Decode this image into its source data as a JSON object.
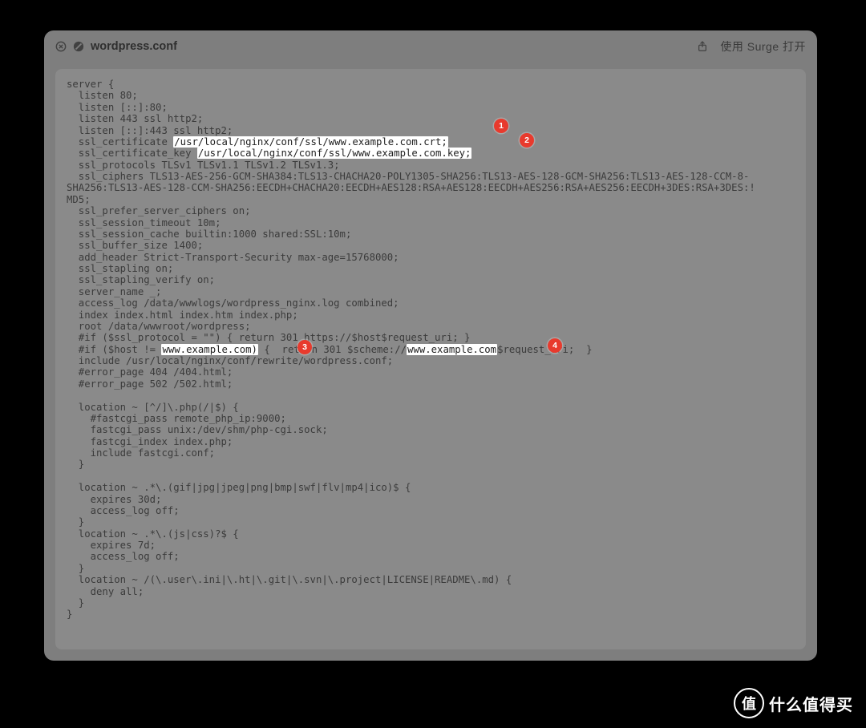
{
  "titlebar": {
    "close_label": "close",
    "cancel_label": "cancel",
    "filename": "wordpress.conf",
    "share_label": "share",
    "open_with_label": "使用 Surge 打开"
  },
  "badges": {
    "1": "1",
    "2": "2",
    "3": "3",
    "4": "4"
  },
  "highlights": {
    "crt": "/usr/local/nginx/conf/ssl/www.example.com.crt;",
    "key": "/usr/local/nginx/conf/ssl/www.example.com.key;",
    "host1": "www.example.com)",
    "host2": "www.example.com"
  },
  "code": {
    "pre1": "server {\n  listen 80;\n  listen [::]:80;\n  listen 443 ssl http2;\n  listen [::]:443 ssl http2;\n  ssl_certificate ",
    "post1": "\n  ssl_certificate_key ",
    "post2": "\n  ssl_protocols TLSv1 TLSv1.1 TLSv1.2 TLSv1.3;\n  ssl_ciphers TLS13-AES-256-GCM-SHA384:TLS13-CHACHA20-POLY1305-SHA256:TLS13-AES-128-GCM-SHA256:TLS13-AES-128-CCM-8-\nSHA256:TLS13-AES-128-CCM-SHA256:EECDH+CHACHA20:EECDH+AES128:RSA+AES128:EECDH+AES256:RSA+AES256:EECDH+3DES:RSA+3DES:!\nMD5;\n  ssl_prefer_server_ciphers on;\n  ssl_session_timeout 10m;\n  ssl_session_cache builtin:1000 shared:SSL:10m;\n  ssl_buffer_size 1400;\n  add_header Strict-Transport-Security max-age=15768000;\n  ssl_stapling on;\n  ssl_stapling_verify on;\n  server_name _;\n  access_log /data/wwwlogs/wordpress_nginx.log combined;\n  index index.html index.htm index.php;\n  root /data/wwwroot/wordpress;\n  #if ($ssl_protocol = \"\") { return 301 https://$host$request_uri; }\n  #if ($host != ",
    "mid3": " {  return 301 $scheme://",
    "post4": "$request_uri;  }\n  include /usr/local/nginx/conf/rewrite/wordpress.conf;\n  #error_page 404 /404.html;\n  #error_page 502 /502.html;\n\n  location ~ [^/]\\.php(/|$) {\n    #fastcgi_pass remote_php_ip:9000;\n    fastcgi_pass unix:/dev/shm/php-cgi.sock;\n    fastcgi_index index.php;\n    include fastcgi.conf;\n  }\n\n  location ~ .*\\.(gif|jpg|jpeg|png|bmp|swf|flv|mp4|ico)$ {\n    expires 30d;\n    access_log off;\n  }\n  location ~ .*\\.(js|css)?$ {\n    expires 7d;\n    access_log off;\n  }\n  location ~ /(\\.user\\.ini|\\.ht|\\.git|\\.svn|\\.project|LICENSE|README\\.md) {\n    deny all;\n  }\n}"
  },
  "watermark": {
    "glyph": "值",
    "text": "什么值得买"
  }
}
